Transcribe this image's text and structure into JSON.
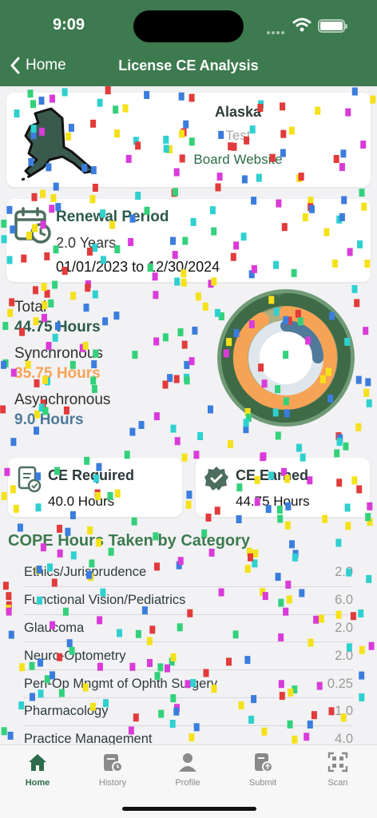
{
  "status_bar": {
    "time": "9:09"
  },
  "nav": {
    "back_label": "Home",
    "title": "License CE Analysis"
  },
  "state": {
    "name": "Alaska",
    "subtitle": "Test",
    "board_link": "Board Website"
  },
  "renewal": {
    "title": "Renewal Period",
    "years": "2.0 Years",
    "dates": "01/01/2023 to 12/30/2024"
  },
  "summary": {
    "total_label": "Total",
    "total_value": "44.75 Hours",
    "sync_label": "Synchronous",
    "sync_value": "35.75 Hours",
    "async_label": "Asynchronous",
    "async_value": "9.0 Hours"
  },
  "colors": {
    "brand": "#3d7a4f",
    "sync": "#f7a356",
    "async": "#4f7a99",
    "ring_outer": "#6f9a75"
  },
  "ce_required": {
    "label": "CE Required",
    "value": "40.0 Hours"
  },
  "ce_earned": {
    "label": "CE Earned",
    "value": "44.75 Hours"
  },
  "categories": {
    "heading": "COPE Hours Taken by Category",
    "rows": [
      {
        "name": "Ethics/Jurisprudence",
        "hours": "2.0"
      },
      {
        "name": "Functional Vision/Pediatrics",
        "hours": "6.0"
      },
      {
        "name": "Glaucoma",
        "hours": "2.0"
      },
      {
        "name": "Neuro-Optometry",
        "hours": "2.0"
      },
      {
        "name": "Peri-Op Mngmt of Ophth Surgery",
        "hours": "0.25"
      },
      {
        "name": "Pharmacology",
        "hours": "1.0"
      },
      {
        "name": "Practice Management",
        "hours": "4.0"
      }
    ]
  },
  "tabs": [
    {
      "label": "Home",
      "icon": "house-icon"
    },
    {
      "label": "History",
      "icon": "history-icon"
    },
    {
      "label": "Profile",
      "icon": "person-icon"
    },
    {
      "label": "Submit",
      "icon": "submit-icon"
    },
    {
      "label": "Scan",
      "icon": "qr-scan-icon"
    }
  ]
}
